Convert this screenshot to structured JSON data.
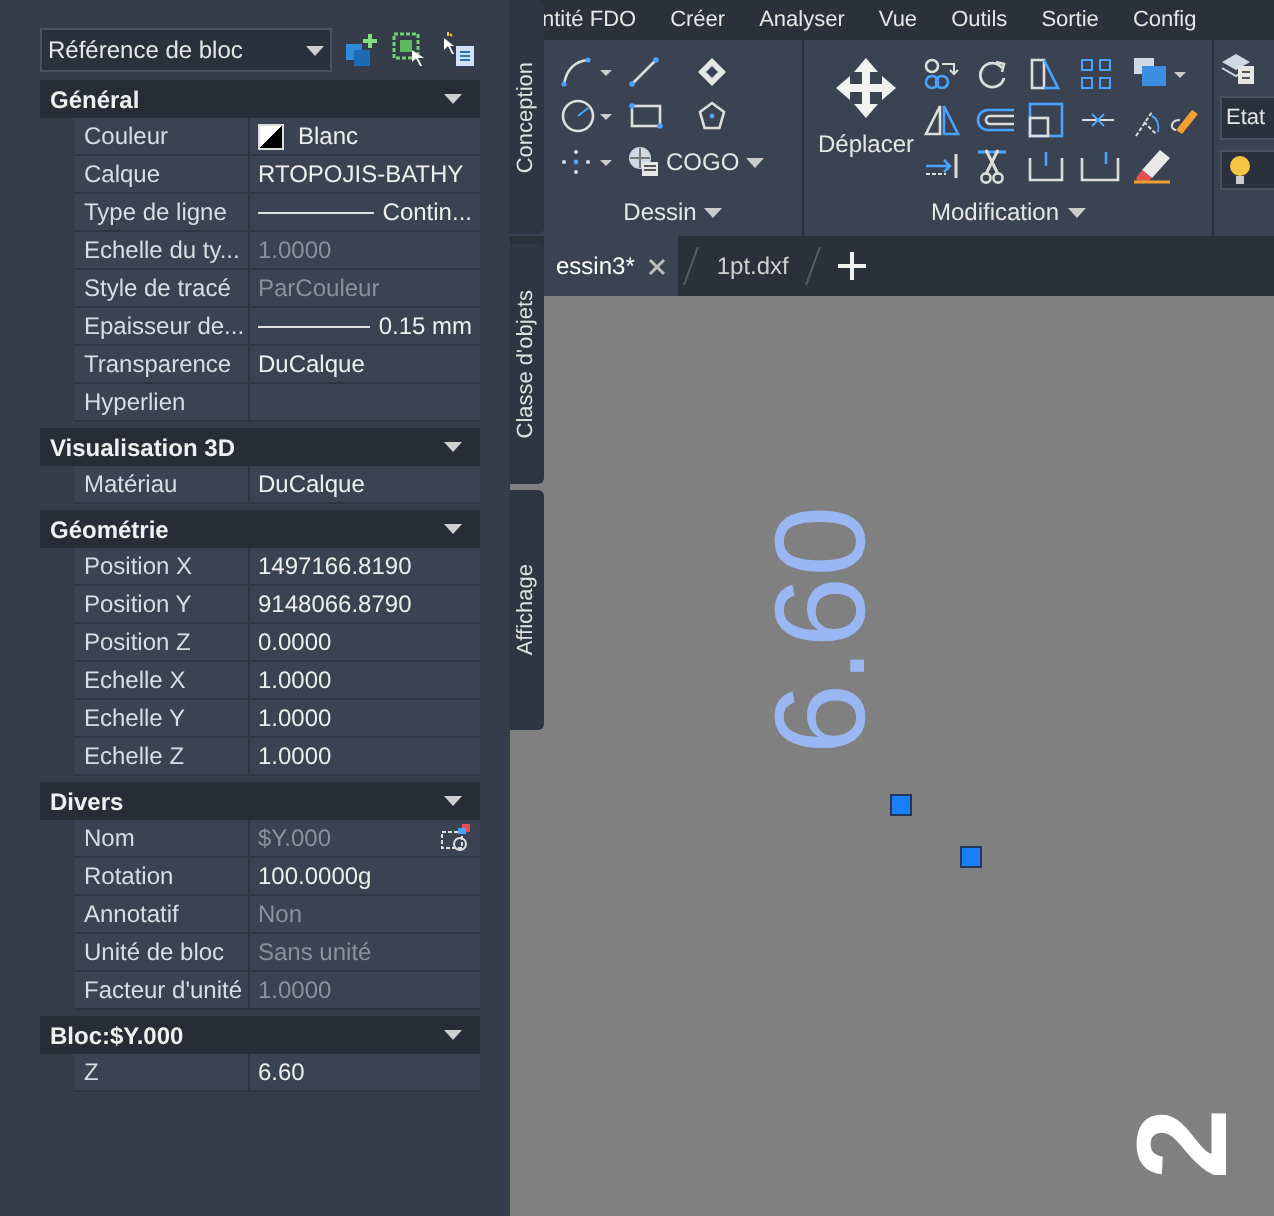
{
  "palette": {
    "object_type": "Référence de bloc",
    "sections": [
      {
        "title": "Général",
        "expanded": true,
        "rows": [
          {
            "label": "Couleur",
            "value": "Blanc",
            "kind": "color",
            "disabled": false
          },
          {
            "label": "Calque",
            "value": "RTOPOJIS-BATHY",
            "kind": "text",
            "disabled": false
          },
          {
            "label": "Type de ligne",
            "value": "Contin...",
            "kind": "line",
            "disabled": false
          },
          {
            "label": "Echelle du ty...",
            "value": "1.0000",
            "kind": "text",
            "disabled": true
          },
          {
            "label": "Style de tracé",
            "value": "ParCouleur",
            "kind": "text",
            "disabled": true
          },
          {
            "label": "Epaisseur  de...",
            "value": "0.15 mm",
            "kind": "line",
            "disabled": false
          },
          {
            "label": "Transparence",
            "value": "DuCalque",
            "kind": "text",
            "disabled": false
          },
          {
            "label": "Hyperlien",
            "value": "",
            "kind": "text",
            "disabled": false
          }
        ]
      },
      {
        "title": "Visualisation 3D",
        "expanded": true,
        "rows": [
          {
            "label": "Matériau",
            "value": "DuCalque",
            "kind": "text",
            "disabled": false
          }
        ]
      },
      {
        "title": "Géométrie",
        "expanded": true,
        "rows": [
          {
            "label": "Position X",
            "value": "1497166.8190",
            "kind": "text",
            "disabled": false
          },
          {
            "label": "Position Y",
            "value": "9148066.8790",
            "kind": "text",
            "disabled": false
          },
          {
            "label": "Position Z",
            "value": "0.0000",
            "kind": "text",
            "disabled": false
          },
          {
            "label": "Echelle X",
            "value": "1.0000",
            "kind": "text",
            "disabled": false
          },
          {
            "label": "Echelle Y",
            "value": "1.0000",
            "kind": "text",
            "disabled": false
          },
          {
            "label": "Echelle Z",
            "value": "1.0000",
            "kind": "text",
            "disabled": false
          }
        ]
      },
      {
        "title": "Divers",
        "expanded": true,
        "rows": [
          {
            "label": "Nom",
            "value": "$Y.000",
            "kind": "pick",
            "disabled": true
          },
          {
            "label": "Rotation",
            "value": "100.0000g",
            "kind": "text",
            "disabled": false
          },
          {
            "label": "Annotatif",
            "value": "Non",
            "kind": "text",
            "disabled": true
          },
          {
            "label": "Unité de bloc",
            "value": "Sans unité",
            "kind": "text",
            "disabled": true
          },
          {
            "label": "Facteur d'unité",
            "value": "1.0000",
            "kind": "text",
            "disabled": true
          }
        ]
      },
      {
        "title": "Bloc:$Y.000",
        "expanded": true,
        "rows": [
          {
            "label": "Z",
            "value": "6.60",
            "kind": "text",
            "disabled": false
          }
        ]
      }
    ]
  },
  "side_tabs": [
    "Conception",
    "Classe d'objets",
    "Affichage"
  ],
  "menu": [
    "ntité FDO",
    "Créer",
    "Analyser",
    "Vue",
    "Outils",
    "Sortie",
    "Config"
  ],
  "ribbon": {
    "draw_panel": {
      "title": "Dessin",
      "button": "COGO"
    },
    "modify_panel": {
      "title": "Modification",
      "button": "Déplacer"
    },
    "third_panel": {
      "field": "Etat"
    }
  },
  "doc_tabs": [
    {
      "label": "essin3*",
      "selected": true,
      "closable": true
    },
    {
      "label": "1pt.dxf",
      "selected": false,
      "closable": false
    }
  ],
  "canvas": {
    "labels": [
      "6.60",
      "2"
    ]
  }
}
